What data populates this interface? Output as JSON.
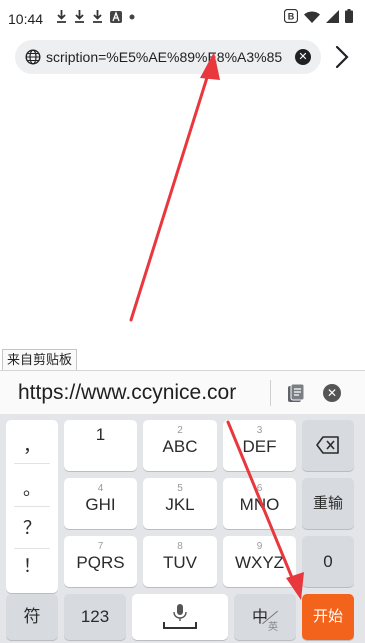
{
  "status_bar": {
    "time": "10:44",
    "left_icons": [
      "download-icon",
      "download-icon",
      "download-icon",
      "app-a-icon",
      "dot-icon"
    ],
    "right_icons": [
      "b-app-icon",
      "wifi-icon",
      "signal-icon",
      "battery-icon"
    ]
  },
  "url_bar": {
    "text": "scription=%E5%AE%89%E8%A3%85",
    "globe_icon": "globe-icon",
    "clear_icon": "clear-icon",
    "forward_icon": "chevron-right-icon"
  },
  "clipboard": {
    "tag": "来自剪贴板",
    "text": "https://www.ccynice.cor"
  },
  "keyboard": {
    "punctuation": [
      "，",
      "。",
      "？",
      "！"
    ],
    "keys": [
      {
        "sub": "",
        "main": "1"
      },
      {
        "sub": "2",
        "main": "ABC"
      },
      {
        "sub": "3",
        "main": "DEF"
      },
      {
        "sub": "4",
        "main": "GHI"
      },
      {
        "sub": "5",
        "main": "JKL"
      },
      {
        "sub": "6",
        "main": "MNO"
      },
      {
        "sub": "7",
        "main": "PQRS"
      },
      {
        "sub": "8",
        "main": "TUV"
      },
      {
        "sub": "9",
        "main": "WXYZ"
      }
    ],
    "delete_icon": "backspace-icon",
    "reenter": "重输",
    "zero": "0",
    "symbol": "符",
    "num": "123",
    "mic_icon": "microphone-icon",
    "lang_main": "中",
    "lang_sub": "英",
    "start": "开始"
  },
  "colors": {
    "accent": "#f4631b",
    "arrow": "#e8383d"
  }
}
